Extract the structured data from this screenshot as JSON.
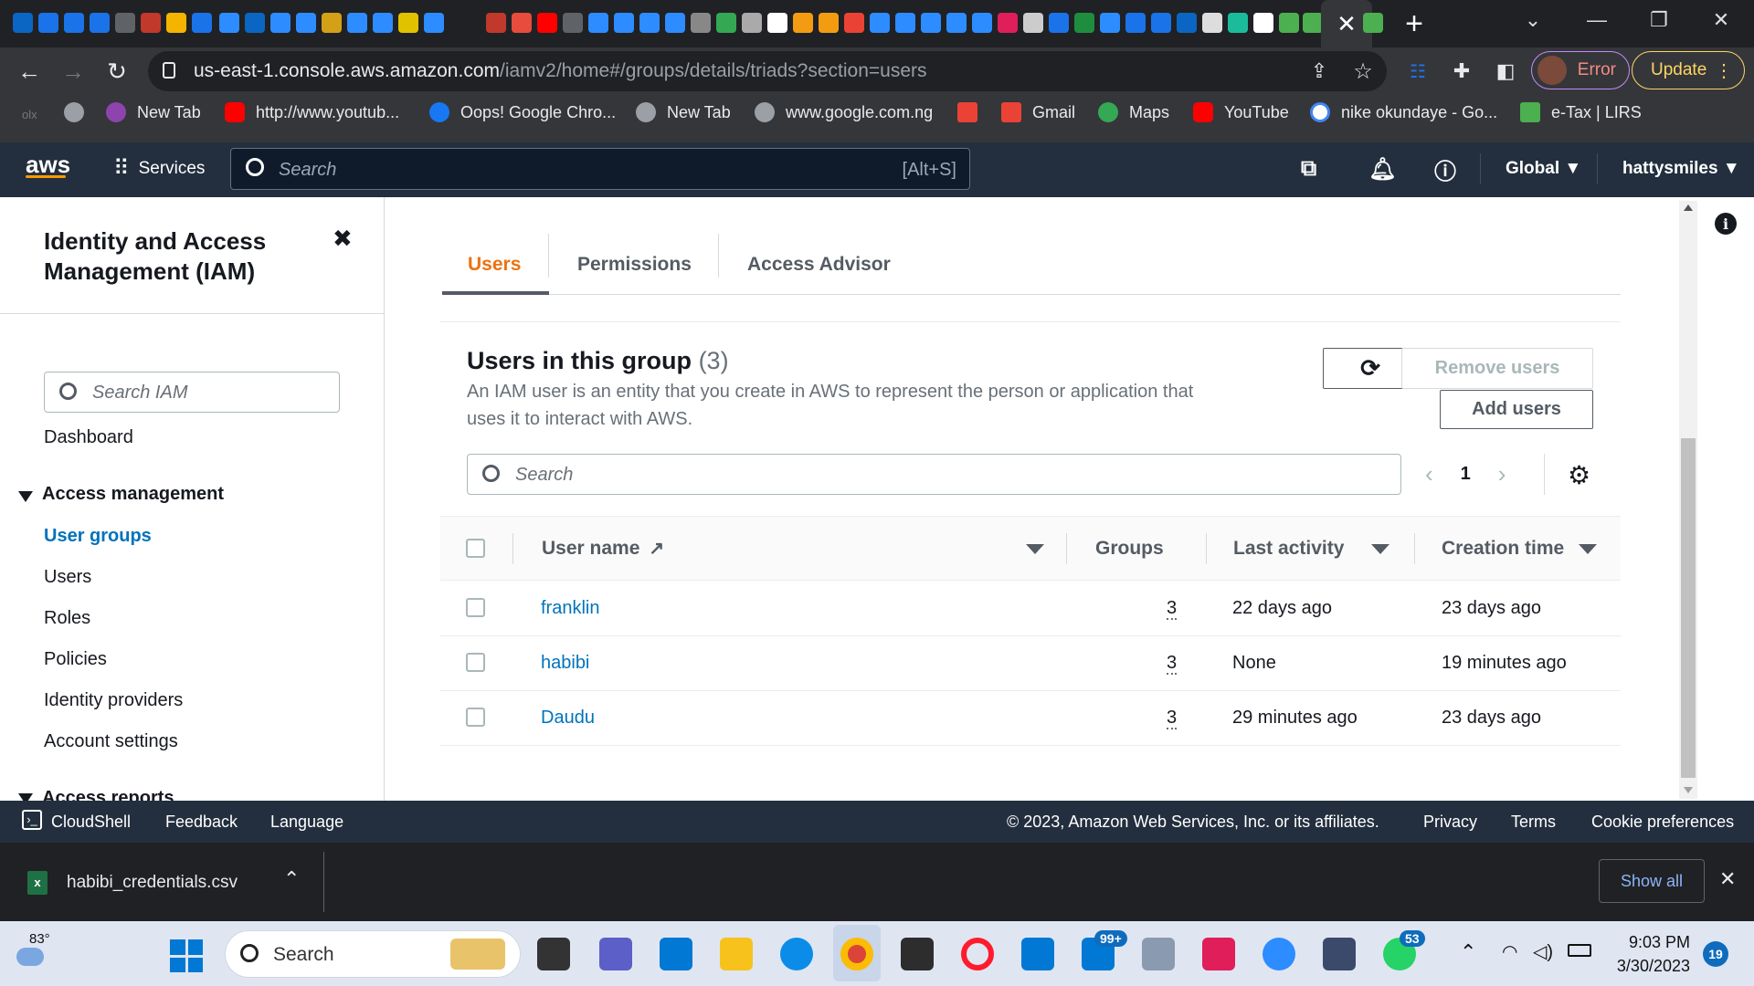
{
  "browser": {
    "url_host": "us-east-1.console.aws.amazon.com",
    "url_path": "/iamv2/home#/groups/details/triads?section=users",
    "profile_status": "Error",
    "update_label": "Update",
    "close_tab_glyph": "✕",
    "new_tab_glyph": "+",
    "bookmarks": [
      {
        "label": "New Tab",
        "icon": "generic-tab-icon",
        "color": "#8e44ad"
      },
      {
        "label": "http://www.youtub...",
        "icon": "youtube-icon",
        "color": "#ff0000"
      },
      {
        "label": "Oops! Google Chro...",
        "icon": "facebook-icon",
        "color": "#1877f2"
      },
      {
        "label": "New Tab",
        "icon": "globe-icon",
        "color": "#9aa0a6"
      },
      {
        "label": "www.google.com.ng",
        "icon": "globe-icon",
        "color": "#9aa0a6"
      },
      {
        "label": "",
        "icon": "numbered-site-icon",
        "color": "#ea4335"
      },
      {
        "label": "Gmail",
        "icon": "gmail-icon",
        "color": "#ea4335"
      },
      {
        "label": "Maps",
        "icon": "maps-icon",
        "color": "#34a853"
      },
      {
        "label": "YouTube",
        "icon": "youtube-icon",
        "color": "#ff0000"
      },
      {
        "label": "nike okundaye - Go...",
        "icon": "google-icon",
        "color": "#ffffff"
      },
      {
        "label": "e-Tax | LIRS",
        "icon": "lirs-icon",
        "color": "#4caf50"
      }
    ]
  },
  "aws_nav": {
    "logo": "aws",
    "services_label": "Services",
    "search_placeholder": "Search",
    "search_shortcut": "[Alt+S]",
    "region": "Global ▼",
    "account": "hattysmiles ▼"
  },
  "sidebar": {
    "title": "Identity and Access Management (IAM)",
    "close_glyph": "✖",
    "search_placeholder": "Search IAM",
    "dashboard": "Dashboard",
    "section": "Access management",
    "items": [
      "User groups",
      "Users",
      "Roles",
      "Policies",
      "Identity providers",
      "Account settings"
    ],
    "active_index": 0,
    "next_section": "Access reports"
  },
  "tabs": [
    "Users",
    "Permissions",
    "Access Advisor"
  ],
  "users_panel": {
    "title": "Users in this group",
    "count": "(3)",
    "description": "An IAM user is an entity that you create in AWS to represent the person or application that uses it to interact with AWS.",
    "remove_button": "Remove users",
    "add_button": "Add users",
    "search_placeholder": "Search",
    "page": "1",
    "columns": [
      "User name",
      "Groups",
      "Last activity",
      "Creation time"
    ],
    "rows": [
      {
        "name": "franklin",
        "groups": "3",
        "last_activity": "22 days ago",
        "creation": "23 days ago"
      },
      {
        "name": "habibi",
        "groups": "3",
        "last_activity": "None",
        "creation": "19 minutes ago"
      },
      {
        "name": "Daudu",
        "groups": "3",
        "last_activity": "29 minutes ago",
        "creation": "23 days ago"
      }
    ]
  },
  "footer": {
    "cloudshell": "CloudShell",
    "feedback": "Feedback",
    "language": "Language",
    "copyright": "© 2023, Amazon Web Services, Inc. or its affiliates.",
    "privacy": "Privacy",
    "terms": "Terms",
    "cookies": "Cookie preferences"
  },
  "downloads": {
    "file": "habibi_credentials.csv",
    "show_all": "Show all"
  },
  "taskbar": {
    "weather": "83°",
    "search_placeholder": "Search",
    "mail_badge": "99+",
    "whatsapp_badge": "53",
    "time": "9:03 PM",
    "date": "3/30/2023",
    "notifications": "19"
  }
}
